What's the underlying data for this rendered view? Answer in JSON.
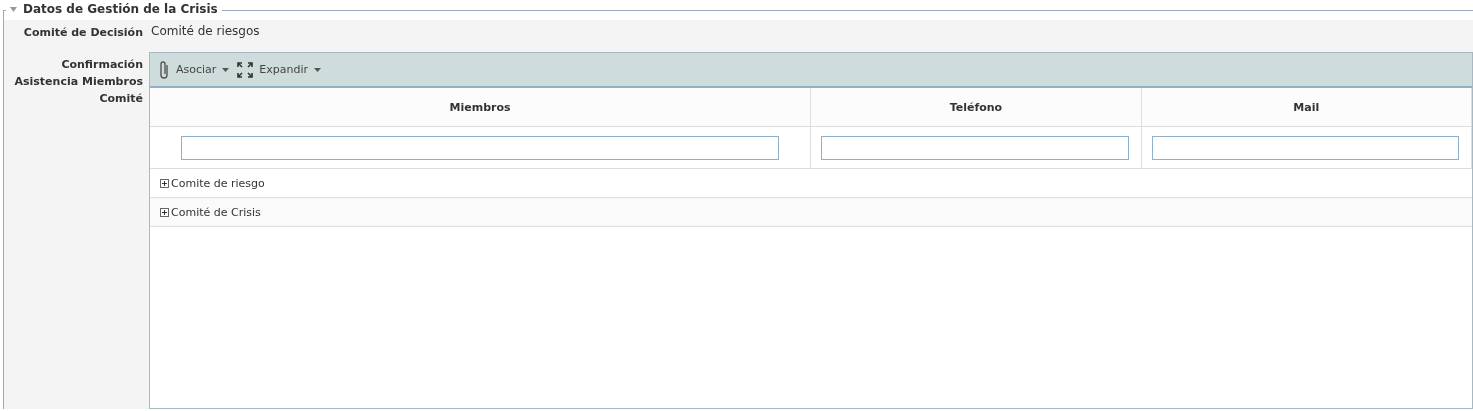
{
  "section": {
    "title": "Datos de Gestión de la Crisis",
    "expanded": true
  },
  "decision": {
    "label": "Comité de Decisión",
    "value": "Comité de riesgos"
  },
  "grid": {
    "label": "Confirmación Asistencia Miembros Comité",
    "toolbar": [
      {
        "kind": "attach",
        "label": "Asociar"
      },
      {
        "kind": "expand",
        "label": "Expandir"
      }
    ],
    "columns": [
      "Miembros",
      "Teléfono",
      "Mail"
    ],
    "groups": [
      {
        "label": "Comite de riesgo",
        "expanded": false
      },
      {
        "label": "Comité de Crisis",
        "expanded": false
      }
    ]
  }
}
